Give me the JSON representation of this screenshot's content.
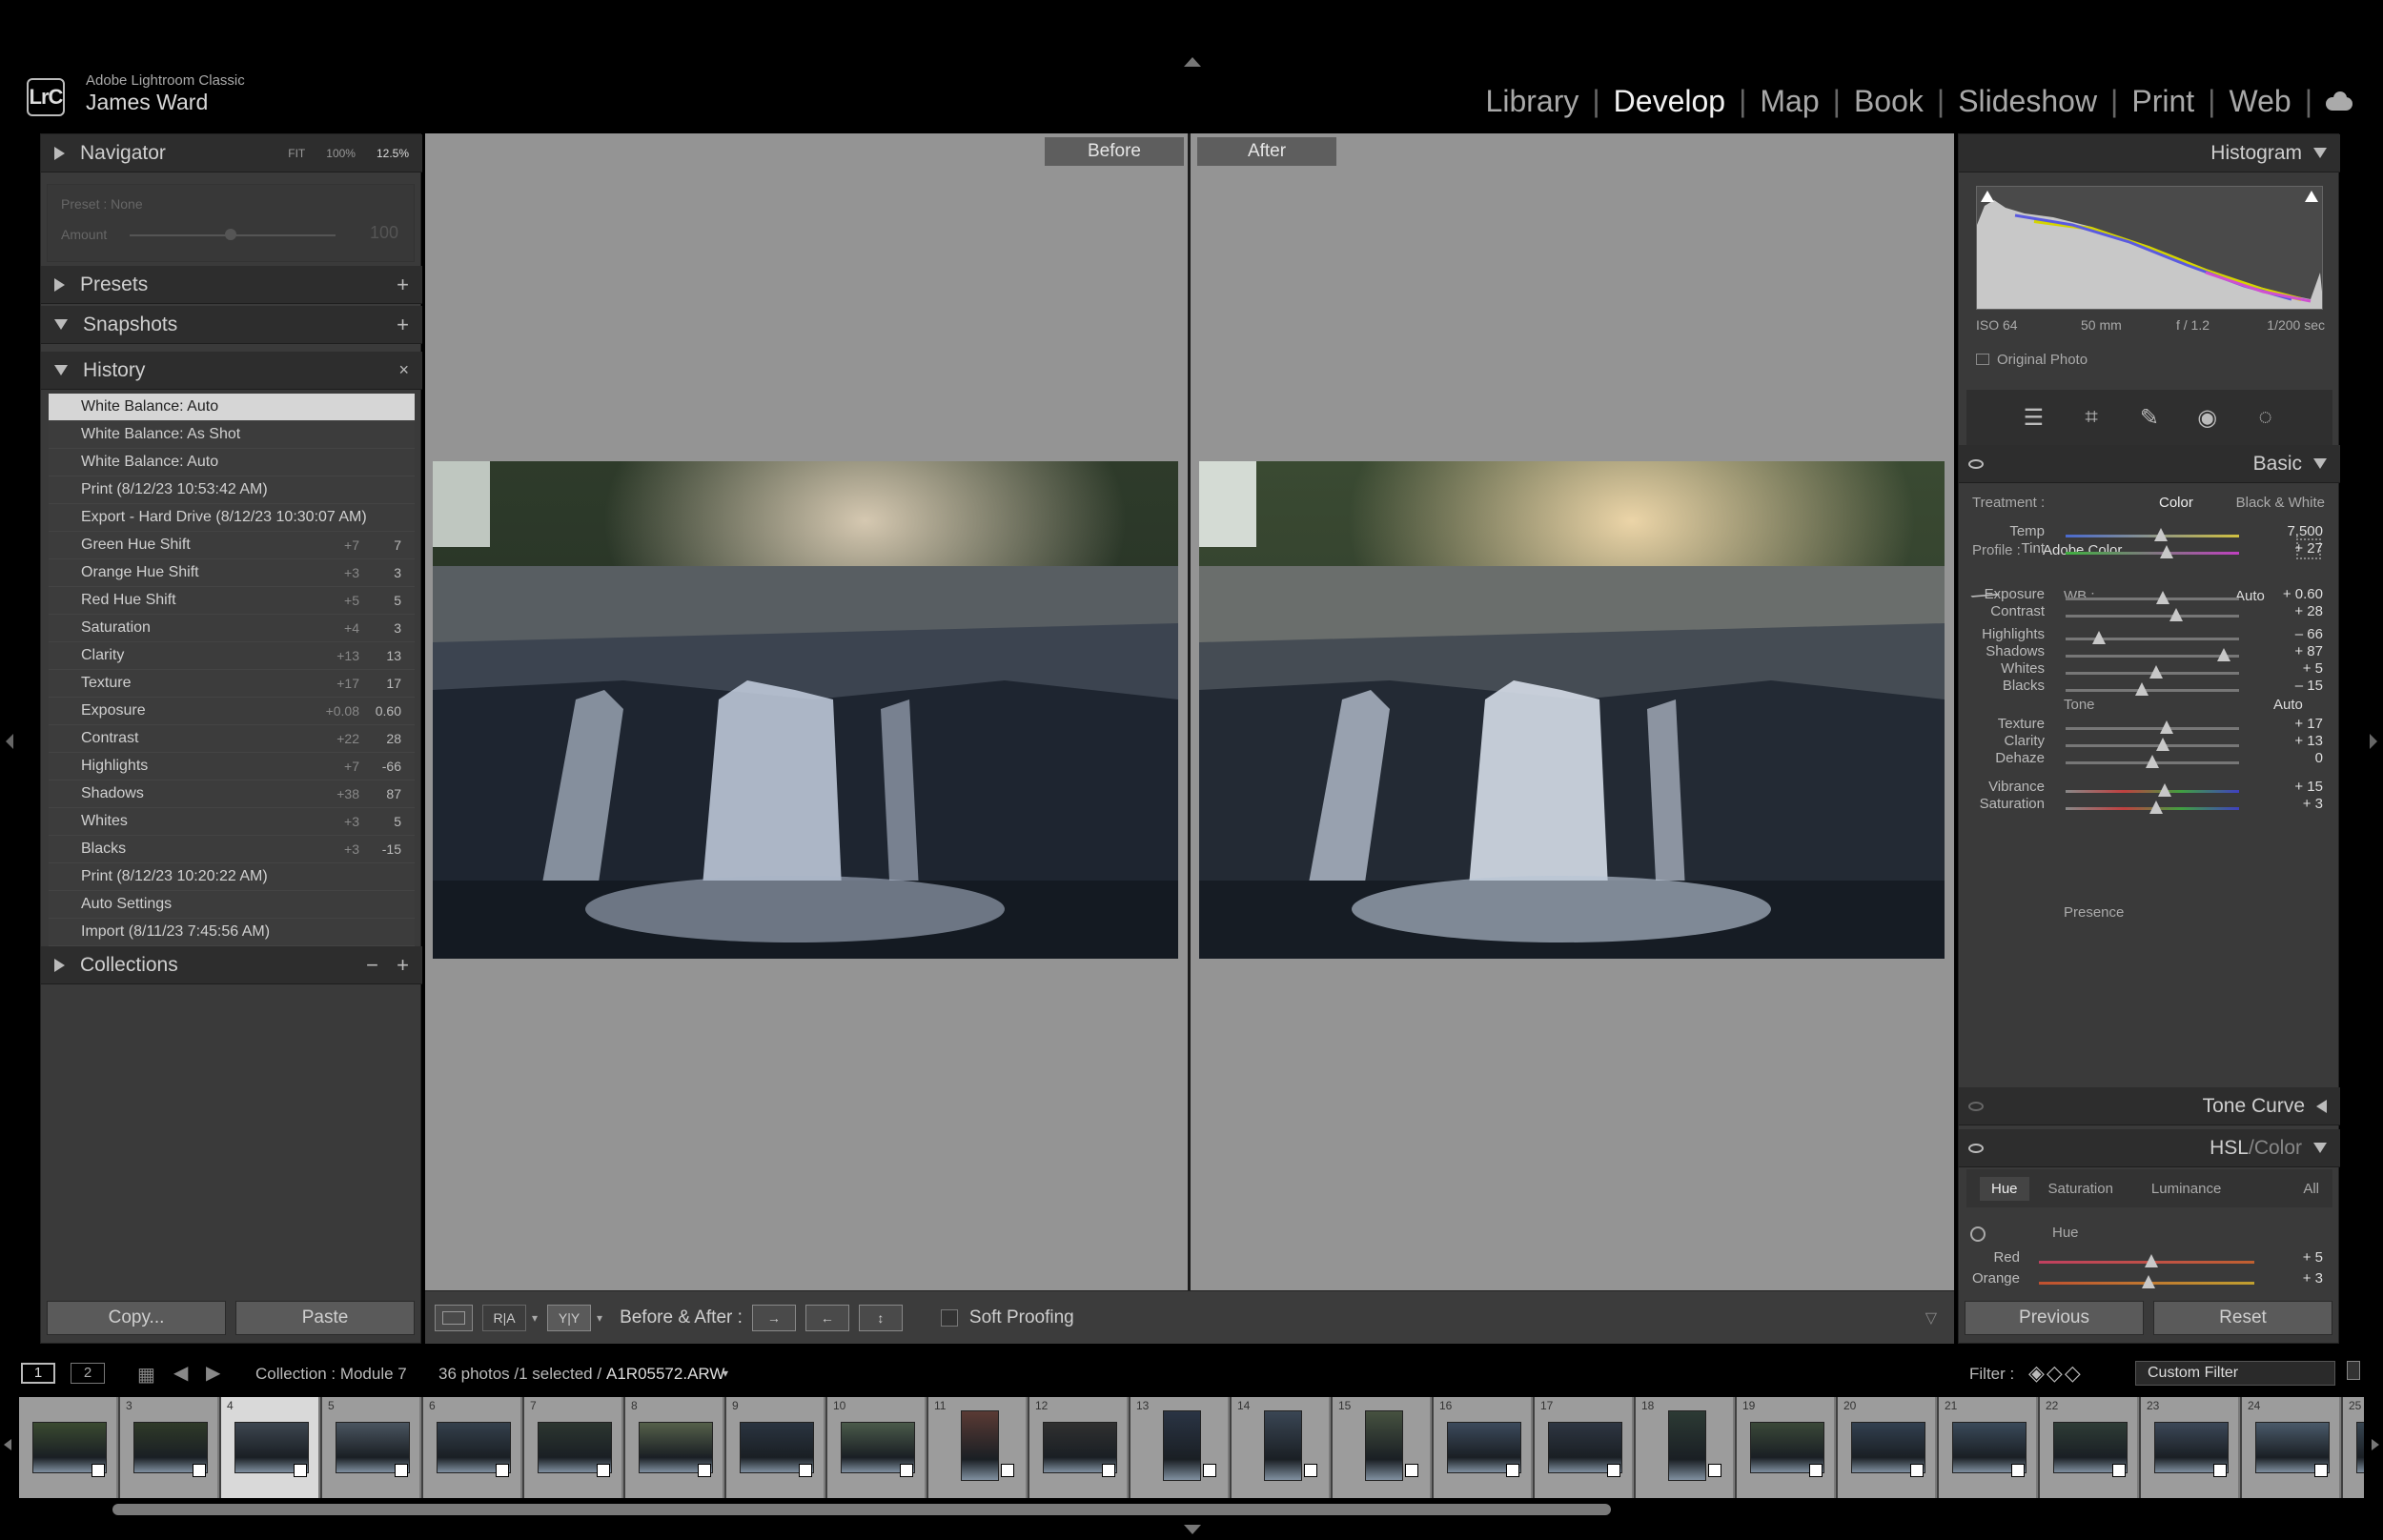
{
  "app": {
    "name": "Adobe Lightroom Classic",
    "logo": "LrC",
    "user": "James Ward"
  },
  "modules": [
    {
      "label": "Library",
      "active": false
    },
    {
      "label": "Develop",
      "active": true
    },
    {
      "label": "Map",
      "active": false
    },
    {
      "label": "Book",
      "active": false
    },
    {
      "label": "Slideshow",
      "active": false
    },
    {
      "label": "Print",
      "active": false
    },
    {
      "label": "Web",
      "active": false
    }
  ],
  "left": {
    "navigator": {
      "title": "Navigator",
      "opts": [
        "FIT",
        "100%",
        "12.5%"
      ]
    },
    "preset": {
      "label": "Preset : None",
      "amount_label": "Amount",
      "amount_value": "100"
    },
    "presets": {
      "title": "Presets",
      "action": "+"
    },
    "snapshots": {
      "title": "Snapshots",
      "action": "+"
    },
    "history": {
      "title": "History",
      "action": "×",
      "items": [
        {
          "label": "White Balance: Auto",
          "d1": "",
          "d2": ""
        },
        {
          "label": "White Balance: As Shot",
          "d1": "",
          "d2": ""
        },
        {
          "label": "White Balance: Auto",
          "d1": "",
          "d2": ""
        },
        {
          "label": "Print (8/12/23 10:53:42 AM)",
          "d1": "",
          "d2": ""
        },
        {
          "label": "Export - Hard Drive (8/12/23 10:30:07 AM)",
          "d1": "",
          "d2": ""
        },
        {
          "label": "Green Hue Shift",
          "d1": "+7",
          "d2": "7"
        },
        {
          "label": "Orange Hue Shift",
          "d1": "+3",
          "d2": "3"
        },
        {
          "label": "Red Hue Shift",
          "d1": "+5",
          "d2": "5"
        },
        {
          "label": "Saturation",
          "d1": "+4",
          "d2": "3"
        },
        {
          "label": "Clarity",
          "d1": "+13",
          "d2": "13"
        },
        {
          "label": "Texture",
          "d1": "+17",
          "d2": "17"
        },
        {
          "label": "Exposure",
          "d1": "+0.08",
          "d2": "0.60"
        },
        {
          "label": "Contrast",
          "d1": "+22",
          "d2": "28"
        },
        {
          "label": "Highlights",
          "d1": "+7",
          "d2": "-66"
        },
        {
          "label": "Shadows",
          "d1": "+38",
          "d2": "87"
        },
        {
          "label": "Whites",
          "d1": "+3",
          "d2": "5"
        },
        {
          "label": "Blacks",
          "d1": "+3",
          "d2": "-15"
        },
        {
          "label": "Print (8/12/23 10:20:22 AM)",
          "d1": "",
          "d2": ""
        },
        {
          "label": "Auto Settings",
          "d1": "",
          "d2": ""
        },
        {
          "label": "Import (8/11/23 7:45:56 AM)",
          "d1": "",
          "d2": ""
        }
      ]
    },
    "collections": {
      "title": "Collections",
      "minus": "−",
      "plus": "+"
    },
    "copy_label": "Copy...",
    "paste_label": "Paste"
  },
  "center": {
    "before_label": "Before",
    "after_label": "After",
    "toolbar": {
      "before_after_label": "Before & After :",
      "soft_proofing_label": "Soft Proofing",
      "view_ra": "R|A",
      "view_yy": "Y|Y"
    }
  },
  "right": {
    "histogram": {
      "title": "Histogram",
      "iso": "ISO 64",
      "focal": "50 mm",
      "aperture": "f / 1.2",
      "shutter": "1/200 sec",
      "original_photo": "Original Photo"
    },
    "basic": {
      "title": "Basic",
      "treatment_label": "Treatment :",
      "treatment_color": "Color",
      "treatment_bw": "Black & White",
      "profile_label": "Profile :",
      "profile_value": "Adobe Color",
      "wb_label": "WB :",
      "wb_value": "Auto",
      "tone_label": "Tone",
      "tone_auto": "Auto",
      "presence_label": "Presence",
      "sliders": [
        {
          "label": "Temp",
          "value": "7,500",
          "pos": 0.55,
          "track": "temp"
        },
        {
          "label": "Tint",
          "value": "+ 27",
          "pos": 0.58,
          "track": "tint"
        },
        {
          "label": "Exposure",
          "value": "+ 0.60",
          "pos": 0.56
        },
        {
          "label": "Contrast",
          "value": "+ 28",
          "pos": 0.64
        },
        {
          "label": "Highlights",
          "value": "– 66",
          "pos": 0.19
        },
        {
          "label": "Shadows",
          "value": "+ 87",
          "pos": 0.91
        },
        {
          "label": "Whites",
          "value": "+ 5",
          "pos": 0.52
        },
        {
          "label": "Blacks",
          "value": "– 15",
          "pos": 0.44
        },
        {
          "label": "Texture",
          "value": "+ 17",
          "pos": 0.58
        },
        {
          "label": "Clarity",
          "value": "+ 13",
          "pos": 0.56
        },
        {
          "label": "Dehaze",
          "value": "0",
          "pos": 0.5
        },
        {
          "label": "Vibrance",
          "value": "+ 15",
          "pos": 0.57,
          "track": "vib"
        },
        {
          "label": "Saturation",
          "value": "+ 3",
          "pos": 0.52,
          "track": "sat"
        }
      ]
    },
    "tone_curve": {
      "title": "Tone Curve"
    },
    "hsl": {
      "title_a": "HSL",
      "title_sep": " / ",
      "title_b": "Color",
      "tabs": [
        "Hue",
        "Saturation",
        "Luminance",
        "All"
      ],
      "hue_label": "Hue",
      "sliders": [
        {
          "label": "Red",
          "value": "+ 5",
          "pos": 0.52
        },
        {
          "label": "Orange",
          "value": "+ 3",
          "pos": 0.51
        }
      ]
    },
    "previous_label": "Previous",
    "reset_label": "Reset"
  },
  "filmbar": {
    "screen1": "1",
    "screen2": "2",
    "collection": "Collection : Module 7",
    "count": "36 photos /1 selected /",
    "filename": "A1R05572.ARW",
    "filter_label": "Filter :",
    "filter_value": "Custom Filter"
  },
  "filmstrip": [
    {
      "num": "",
      "c": "#3a4a30",
      "sel": false
    },
    {
      "num": "3",
      "c": "#2f3a28",
      "sel": false
    },
    {
      "num": "4",
      "c": "#3d4650",
      "sel": true
    },
    {
      "num": "5",
      "c": "#4a5560",
      "sel": false
    },
    {
      "num": "6",
      "c": "#34404c",
      "sel": false
    },
    {
      "num": "7",
      "c": "#2c3630",
      "sel": false
    },
    {
      "num": "8",
      "c": "#55604a",
      "sel": false
    },
    {
      "num": "9",
      "c": "#2a3440",
      "sel": false
    },
    {
      "num": "10",
      "c": "#4a5a4a",
      "sel": false
    },
    {
      "num": "11",
      "c": "#5a3a34",
      "sel": false,
      "tall": true
    },
    {
      "num": "12",
      "c": "#303030",
      "sel": false
    },
    {
      "num": "13",
      "c": "#2a3444",
      "sel": false,
      "tall": true
    },
    {
      "num": "14",
      "c": "#3a4654",
      "sel": false,
      "tall": true
    },
    {
      "num": "15",
      "c": "#465240",
      "sel": false,
      "tall": true
    },
    {
      "num": "16",
      "c": "#3c4a5c",
      "sel": false
    },
    {
      "num": "17",
      "c": "#2e3642",
      "sel": false
    },
    {
      "num": "18",
      "c": "#2c3a34",
      "sel": false,
      "tall": true
    },
    {
      "num": "19",
      "c": "#3a4838",
      "sel": false
    },
    {
      "num": "20",
      "c": "#324050",
      "sel": false
    },
    {
      "num": "21",
      "c": "#3a4a5a",
      "sel": false
    },
    {
      "num": "22",
      "c": "#2e3c36",
      "sel": false
    },
    {
      "num": "23",
      "c": "#3c4858",
      "sel": false
    },
    {
      "num": "24",
      "c": "#4a5a6a",
      "sel": false
    },
    {
      "num": "25",
      "c": "#384652",
      "sel": false
    }
  ]
}
